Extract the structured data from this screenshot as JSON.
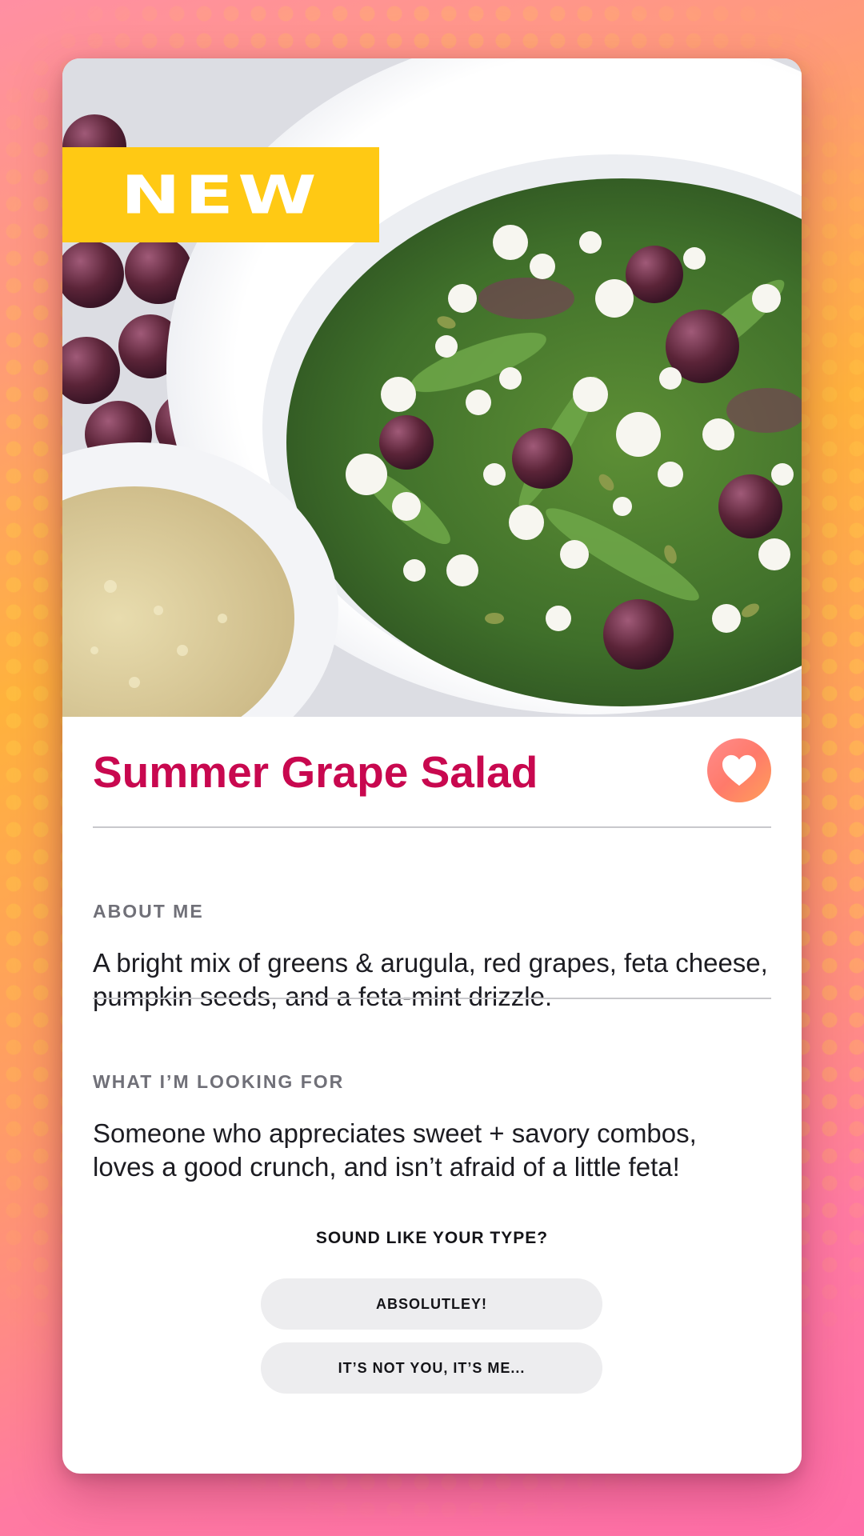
{
  "badge": {
    "label": "NEW"
  },
  "profile": {
    "title": "Summer Grape Salad",
    "favorite_icon": "heart-icon"
  },
  "about": {
    "label": "ABOUT ME",
    "text": "A bright mix of greens & arugula, red grapes, feta cheese, pumpkin seeds, and a feta-mint drizzle."
  },
  "looking_for": {
    "label": "WHAT I’M LOOKING FOR",
    "text": "Someone who appreciates sweet + savory combos, loves a good crunch, and isn’t afraid of a little feta!"
  },
  "prompt": {
    "question": "SOUND LIKE YOUR TYPE?"
  },
  "actions": {
    "accept_label": "ABSOLUTLEY!",
    "decline_label": "IT’S NOT YOU, IT’S ME..."
  },
  "colors": {
    "title": "#c8084f",
    "badge": "#ffc914",
    "pill": "#ededef"
  }
}
